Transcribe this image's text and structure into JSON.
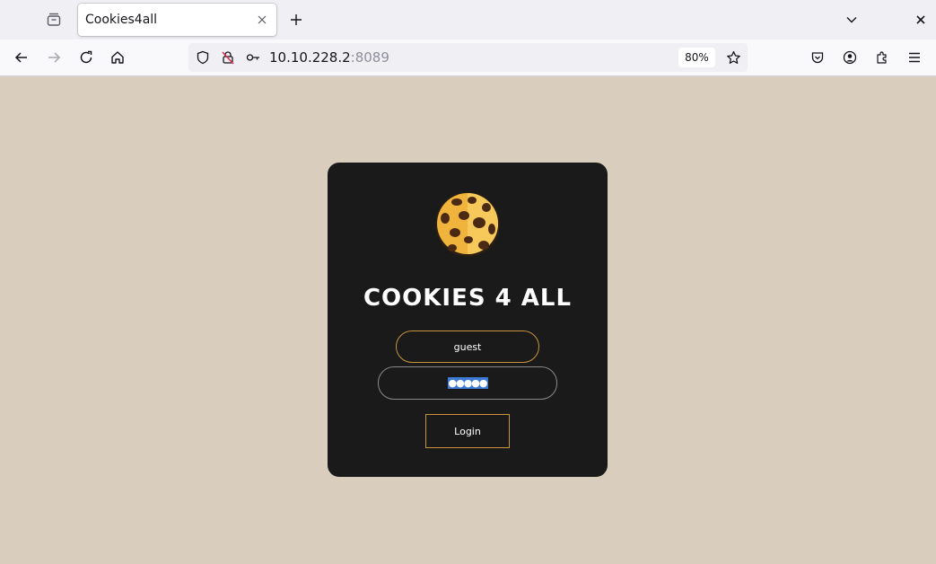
{
  "browser": {
    "tab_title": "Cookies4all",
    "url_host": "10.10.228.2",
    "url_port": ":8089",
    "zoom": "80%",
    "icons": [
      "tab-list-icon",
      "close-icon",
      "plus-icon",
      "chevron-down-icon",
      "close-icon",
      "back-arrow-icon",
      "forward-arrow-icon",
      "reload-icon",
      "home-icon",
      "shield-icon",
      "insecure-lock-icon",
      "key-icon",
      "star-icon",
      "pocket-icon",
      "account-icon",
      "extensions-icon",
      "menu-icon"
    ]
  },
  "page": {
    "background": "#d9cdbd",
    "card_color": "#1b1a1b",
    "accent": "#c9943f",
    "title": "COOKIES 4 ALL",
    "username_value": "guest",
    "password_mask": "●●●●●",
    "login_label": "Login"
  }
}
